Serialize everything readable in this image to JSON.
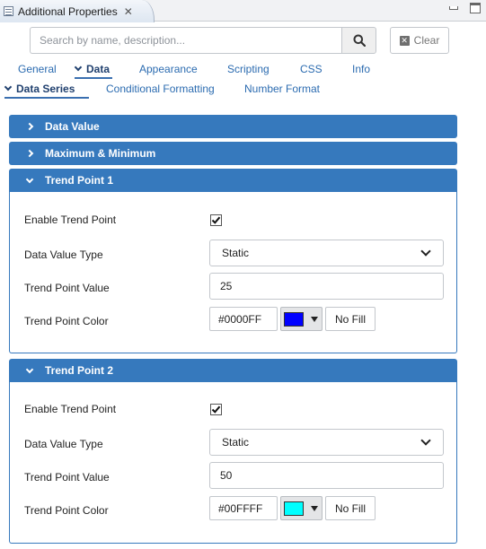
{
  "window": {
    "tab_title": "Additional Properties",
    "close_glyph": "✕",
    "controls": [
      "minimize-icon",
      "maximize-icon"
    ]
  },
  "search": {
    "placeholder": "Search by name, description...",
    "value": "",
    "clear_label": "Clear"
  },
  "tabs": [
    {
      "label": "General",
      "active": false
    },
    {
      "label": "Data",
      "active": true
    },
    {
      "label": "Appearance",
      "active": false
    },
    {
      "label": "Scripting",
      "active": false
    },
    {
      "label": "CSS",
      "active": false
    },
    {
      "label": "Info",
      "active": false
    }
  ],
  "subtabs": [
    {
      "label": "Data Series",
      "active": true
    },
    {
      "label": "Conditional Formatting",
      "active": false
    },
    {
      "label": "Number Format",
      "active": false
    }
  ],
  "sections": {
    "data_value": {
      "title": "Data Value",
      "expanded": false
    },
    "max_min": {
      "title": "Maximum & Minimum",
      "expanded": false
    },
    "trend1": {
      "title": "Trend Point 1",
      "expanded": true,
      "enable_label": "Enable Trend Point",
      "enabled": true,
      "type_label": "Data Value Type",
      "type_value": "Static",
      "value_label": "Trend Point Value",
      "value": "25",
      "color_label": "Trend Point Color",
      "color_hex": "#0000FF",
      "swatch": "#0000ff",
      "nofill_label": "No Fill"
    },
    "trend2": {
      "title": "Trend Point 2",
      "expanded": true,
      "enable_label": "Enable Trend Point",
      "enabled": true,
      "type_label": "Data Value Type",
      "type_value": "Static",
      "value_label": "Trend Point Value",
      "value": "50",
      "color_label": "Trend Point Color",
      "color_hex": "#00FFFF",
      "swatch": "#00ffff",
      "nofill_label": "No Fill"
    }
  },
  "colors": {
    "accent": "#3679bd",
    "tab_link": "#2b6bb0",
    "active_tab": "#1f3f6e"
  }
}
